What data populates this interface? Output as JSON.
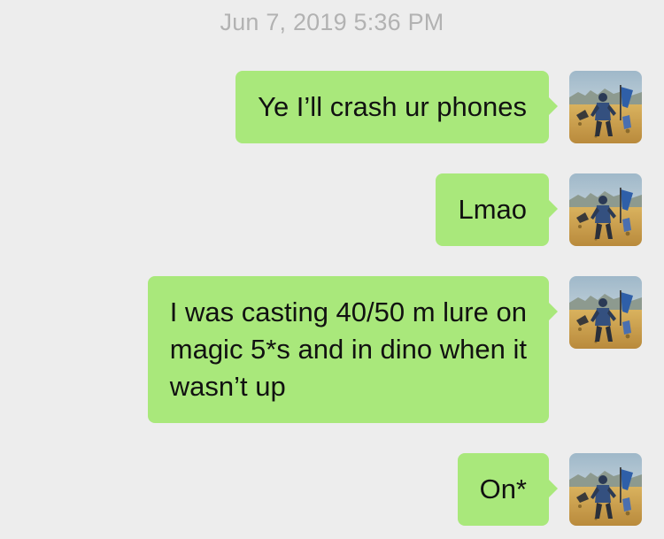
{
  "timestamp": "Jun 7, 2019 5:36 PM",
  "messages": [
    {
      "lines": [
        "Ye I’ll crash ur phones"
      ],
      "avatar": "game-character-avatar"
    },
    {
      "lines": [
        "Lmao"
      ],
      "avatar": "game-character-avatar"
    },
    {
      "lines": [
        "I was casting 40/50 m lure on",
        "magic 5*s and in dino when it",
        "wasn’t up"
      ],
      "avatar": "game-character-avatar"
    },
    {
      "lines": [
        "On*"
      ],
      "avatar": "game-character-avatar"
    }
  ],
  "colors": {
    "background": "#ededed",
    "bubble": "#a9e87b",
    "text": "#111111",
    "timestamp": "#b2b2b2"
  }
}
